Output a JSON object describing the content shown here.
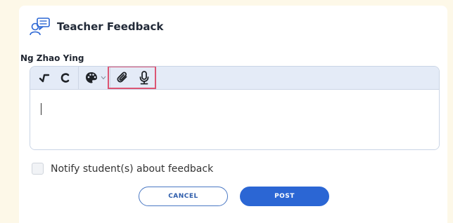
{
  "header": {
    "title": "Teacher Feedback",
    "icon": "feedback-chat-icon"
  },
  "student": {
    "name": "Ng Zhao Ying"
  },
  "editor": {
    "toolbar": [
      {
        "name": "tick-mark-icon",
        "label": "Tick"
      },
      {
        "name": "cross-mark-icon",
        "label": "Cross"
      },
      {
        "name": "palette-icon",
        "label": "Colour"
      },
      {
        "name": "attachment-icon",
        "label": "Attach"
      },
      {
        "name": "microphone-icon",
        "label": "Record audio"
      }
    ],
    "value": ""
  },
  "notify": {
    "label": "Notify student(s) about feedback",
    "checked": false
  },
  "buttons": {
    "cancel": "CANCEL",
    "post": "POST"
  },
  "colors": {
    "accent": "#2b66d4",
    "highlight": "#dc5573",
    "toolbar_bg": "#e4ebf7",
    "page_bg": "#fdf8e8"
  }
}
